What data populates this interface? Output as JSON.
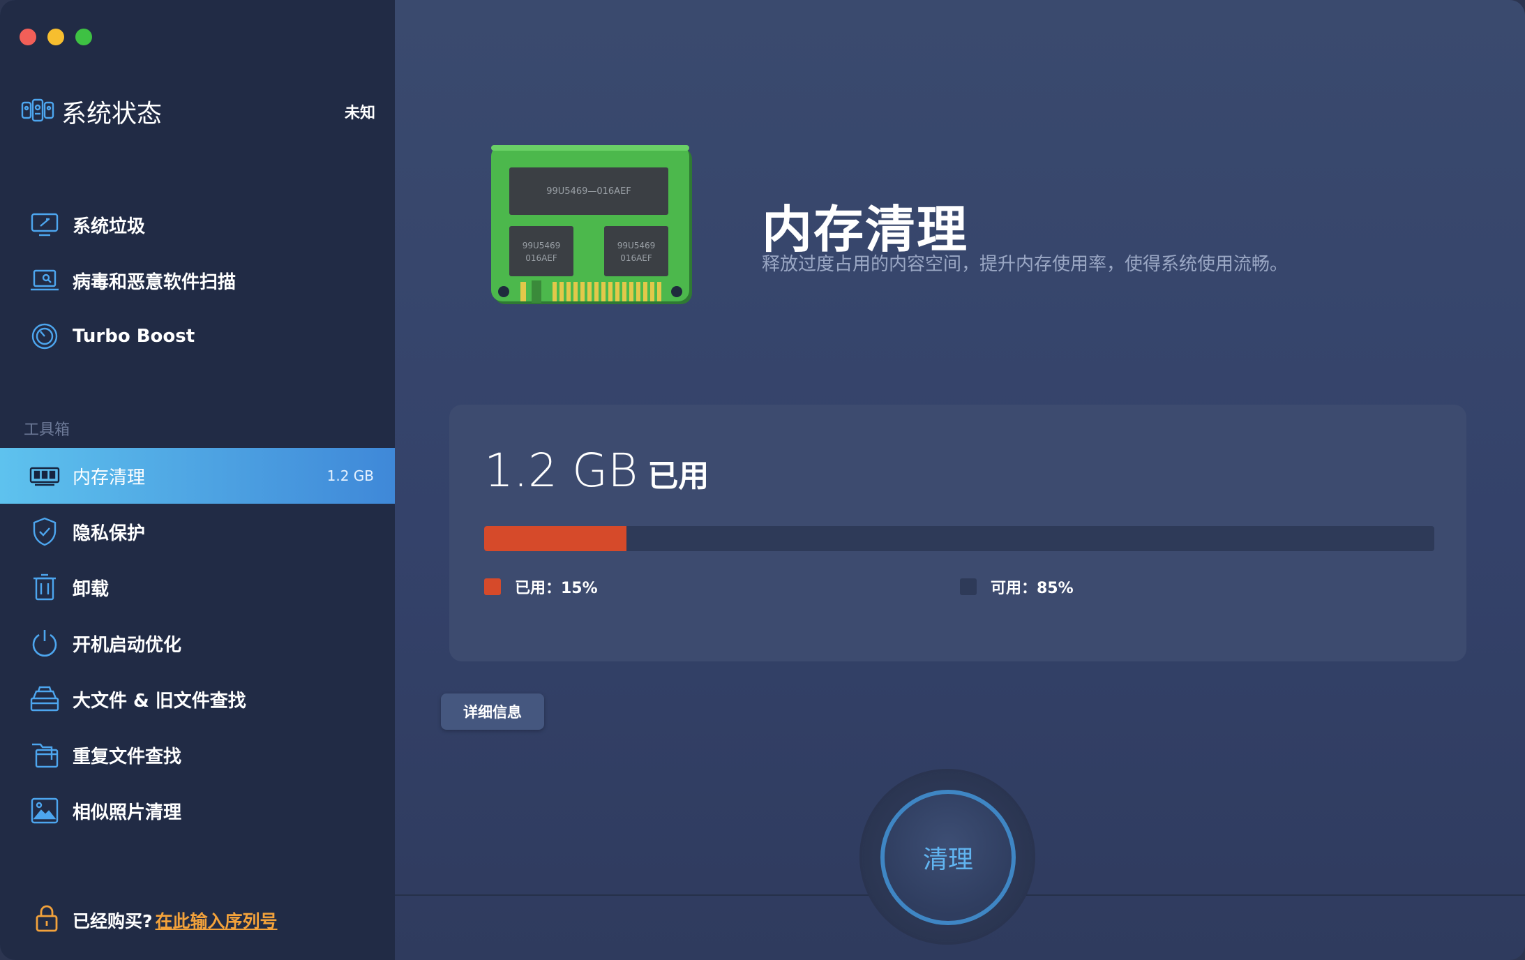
{
  "window": {
    "traffic_lights": [
      "close",
      "minimize",
      "zoom"
    ]
  },
  "sidebar": {
    "status": {
      "title": "系统状态",
      "value": "未知",
      "icon": "system-status-icon"
    },
    "items": [
      {
        "label": "系统垃圾",
        "icon": "monitor-broom-icon"
      },
      {
        "label": "病毒和恶意软件扫描",
        "icon": "laptop-scan-icon"
      },
      {
        "label": "Turbo Boost",
        "icon": "speedometer-icon"
      }
    ],
    "toolbox_label": "工具箱",
    "tools": [
      {
        "label": "内存清理",
        "badge": "1.2 GB",
        "icon": "memory-icon",
        "active": true
      },
      {
        "label": "隐私保护",
        "icon": "shield-check-icon"
      },
      {
        "label": "卸载",
        "icon": "trash-icon"
      },
      {
        "label": "开机启动优化",
        "icon": "power-icon"
      },
      {
        "label": "大文件 & 旧文件查找",
        "icon": "file-box-icon"
      },
      {
        "label": "重复文件查找",
        "icon": "duplicate-folder-icon"
      },
      {
        "label": "相似照片清理",
        "icon": "photo-icon"
      }
    ],
    "purchase": {
      "text": "已经购买?",
      "link": "在此输入序列号",
      "icon": "lock-icon"
    }
  },
  "main": {
    "title": "内存清理",
    "subtitle": "释放过度占用的内容空间，提升内存使用率，使得系统使用流畅。",
    "ram_chip_labels": [
      "99U5469—016AEF",
      "99U5469",
      "016AEF",
      "99U5469",
      "016AEF"
    ],
    "usage": {
      "amount": "1.2 GB",
      "suffix": "已用",
      "used_fraction": 0.15,
      "legend_used": "已用：15%",
      "legend_free": "可用：85%"
    },
    "details_button": "详细信息",
    "clean_button": "清理",
    "colors": {
      "used": "#d64a2a",
      "free": "#2e3a58",
      "accent": "#4fa3e6",
      "link": "#f3a23b"
    }
  }
}
